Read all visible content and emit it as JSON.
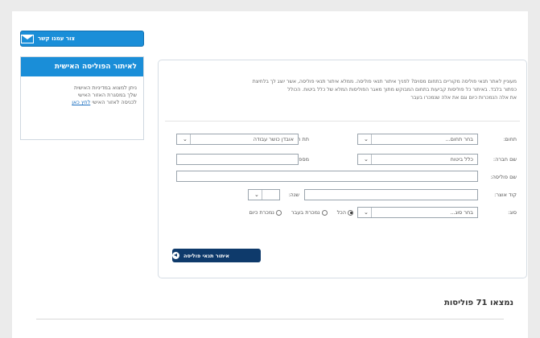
{
  "contact_button": {
    "label": "צור עמנו קשר",
    "icon": "envelope-icon"
  },
  "side_box": {
    "title": "לאיתור הפוליסה האישית",
    "text_line1": "ניתן למצוא במדיניות האישית",
    "text_line2": "שלך במסגרת האזור האישי",
    "text_line3": "לכניסה לאזור האישי",
    "link": "לחץ כאן"
  },
  "intro": {
    "line1": "מעוניין לאתר תנאי פוליסה מקוריים בתחום מסוים? לפניך איתור תנאי פוליסה. ממלא איתור תנאי פוליסה, אשר יוצג לך בלחיצת",
    "line2": "כפתור בלבד. באיתור כל פוליסות קביעות בתחום המבוקש מתוך מאגר הפוליסות המלא של כלל ביטוח. הכולל",
    "line3": "את אלה הנמכרות כיום וגם את אלה שנמכרו בעבר"
  },
  "form": {
    "row1": {
      "domain_label": "תחום:",
      "domain_value": "בחר תחום...",
      "subdomain_label": "תת תחום:",
      "subdomain_value": "אובדן כושר עבודה"
    },
    "row2": {
      "company_label": "שם חברה:",
      "company_value": "כלל ביטוח",
      "plan_label": "מספר תכנית:",
      "plan_value": ""
    },
    "row3": {
      "policy_label": "שם פוליסה:",
      "policy_value": ""
    },
    "row4": {
      "code_label": "קוד אוצר:",
      "code_value": "",
      "year_label": "שנה:",
      "year_value": ""
    },
    "row5": {
      "status_label": "סוג:",
      "status_value": "בחר סוג...",
      "radio_options": [
        "הכל",
        "נמכרת בעבר",
        "נמכרת כיום"
      ],
      "radio_selected": 0
    }
  },
  "search_button": {
    "label": "איתור תנאי פוליסה",
    "icon": "arrow-left-icon"
  },
  "results": {
    "text": "נמצאו 71 פוליסות"
  }
}
